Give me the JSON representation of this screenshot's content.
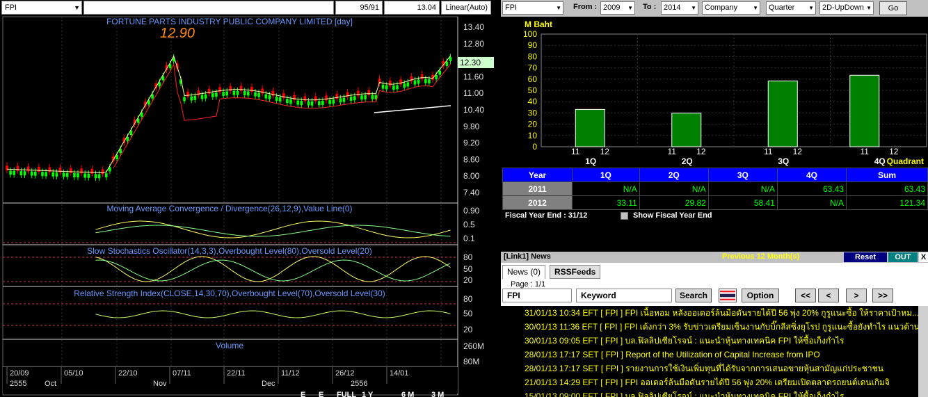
{
  "stock": {
    "symbol": "FPI",
    "counter": "95/91",
    "price_box": "13.04",
    "scale_mode": "Linear(Auto)",
    "company_title": "FORTUNE PARTS INDUSTRY PUBLIC COMPANY LIMITED [day]",
    "last_price_label": "12.90",
    "current_price_tag": "12.30",
    "price_ticks": [
      "13.40",
      "12.80",
      "12.20",
      "11.60",
      "11.00",
      "10.40",
      "9.80",
      "9.20",
      "8.60",
      "8.00",
      "7.40"
    ],
    "macd_title": "Moving Average Convergence / Divergence(26,12,9),Value Line(0)",
    "macd_ticks": [
      "0.90",
      "0.5",
      "0.1"
    ],
    "stoch_title": "Slow Stochastics Oscillator(14,3,3),Overbought Level(80),Oversold Level(20)",
    "stoch_ticks": [
      "80",
      "50",
      "20"
    ],
    "rsi_title": "Relative Strength Index(CLOSE,14,30,70),Overbought Level(70),Oversold Level(30)",
    "rsi_ticks": [
      "80",
      "50",
      "20"
    ],
    "volume_title": "Volume",
    "volume_ticks": [
      "260M",
      "80M"
    ],
    "date_ticks": [
      "20/09",
      "05/10",
      "22/10",
      "07/11",
      "22/11",
      "11/12",
      "26/12",
      "14/01"
    ],
    "month_ticks": [
      "2555",
      "Oct",
      "Nov",
      "Dec",
      "2556"
    ],
    "zoom_buttons": [
      "E",
      "E",
      "FULL",
      "1 Y",
      "6 M",
      "3 M"
    ],
    "colors": {
      "up": "#00ff00",
      "down": "#ff0000",
      "title": "#6699ff",
      "last": "#ff8c1a",
      "ma_short": "#ffffaa",
      "ma_long": "#ff2222"
    }
  },
  "toolbar": {
    "symbol": "FPI",
    "from_label": "From :",
    "from_value": "2009",
    "to_label": "To :",
    "to_value": "2014",
    "company": "Company",
    "period": "Quarter",
    "chart_mode": "2D-UpDown",
    "go_label": "Go"
  },
  "financials": {
    "unit_label": "M Baht",
    "y_ticks": [
      "100",
      "90",
      "80",
      "70",
      "60",
      "50",
      "40",
      "30",
      "20",
      "10",
      "0"
    ],
    "quadrant_label": "Quadrant",
    "quarters": [
      "1Q",
      "2Q",
      "3Q",
      "4Q"
    ],
    "year_short": [
      "11",
      "12"
    ],
    "chart_data": {
      "type": "bar",
      "categories": [
        "1Q-11",
        "1Q-12",
        "2Q-11",
        "2Q-12",
        "3Q-11",
        "3Q-12",
        "4Q-11",
        "4Q-12"
      ],
      "values": [
        null,
        33.11,
        null,
        29.82,
        null,
        58.41,
        63.43,
        null
      ],
      "ylabel": "M Baht",
      "xlabel": "Quadrant",
      "ylim": [
        0,
        100
      ],
      "bar_color": "#008000"
    },
    "table": {
      "headers": [
        "Year",
        "1Q",
        "2Q",
        "3Q",
        "4Q",
        "Sum"
      ],
      "rows": [
        {
          "year": "2011",
          "values": [
            "N/A",
            "N/A",
            "N/A",
            "63.43",
            "63.43"
          ]
        },
        {
          "year": "2012",
          "values": [
            "33.11",
            "29.82",
            "58.41",
            "N/A",
            "121.34"
          ]
        }
      ]
    },
    "fiscal_label": "Fiscal  Year  End  :  31/12",
    "show_fiscal_label": "Show Fiscal Year End"
  },
  "news": {
    "title": "[Link1] News",
    "previous_label": "Previous 12 Month(s)",
    "reset_label": "Reset",
    "out_label": "OUT",
    "close_label": "X",
    "tabs": [
      "News (0)",
      "RSSFeeds"
    ],
    "page_label": "Page : 1/1",
    "symbol": "FPI",
    "keyword_placeholder": "Keyword",
    "search_label": "Search",
    "option_label": "Option",
    "nav": [
      "<<",
      "<",
      ">",
      ">>"
    ],
    "items": [
      "31/01/13 10:34  EFT  [ FPI ]  FPI เนื้อหอม หลังออเดอร์ล้นมือดันรายได้ปี 56 พุ่ง 20% กูรูแนะซื้อ ให้ราคาเป้าหม...",
      "30/01/13 11:36  EFT  [ FPI ]  FPI เด้งกว่า 3% รับข่าวเตรียมเซ็นงานกับบิ๊กลีสซิ่งยุโรป กูรูแนะซื้อยังทำไร แนวต้าน ...",
      "30/01/13 09:05  EFT  [ FPI ]  บล.ฟิลลิปเซียโรจน์ : แนะนำหุ้นทางเทคนิค FPI ให้ซื้อเก็งกำไร",
      "28/01/13 17:17  SET  [ FPI ]  Report of the Utilization of Capital Increase from IPO",
      "28/01/13 17:17  SET  [ FPI ]  รายงานการใช้เงินเพิ่มทุนที่ได้รับจากการเสนอขายหุ้นสามัญแก่ประชาชน",
      "21/01/13 14:29  EFT  [ FPI ]  FPI ออเดอร์ล้นมือดันรายได้ปี 56 พุ่ง 20% เตรียมเปิดตลาดรถยนต์เดนเกิมจิ",
      "15/01/13 09:00  EFT  [ FPI ]  บล.ฟิลลิปเซียโรจน์ : แนะนำหุ้นทางเทคนิค FPI ให้ซื้อเก็งกำไร"
    ]
  }
}
